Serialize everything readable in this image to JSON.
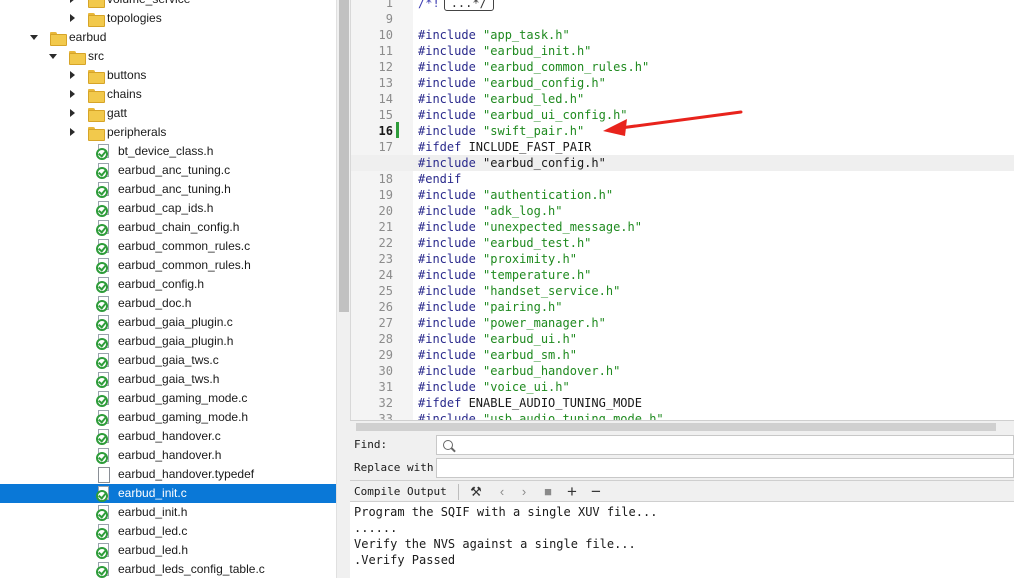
{
  "tree": {
    "items": [
      {
        "label": "volume_service",
        "depth": 3,
        "kind": "folder",
        "expanded": false
      },
      {
        "label": "topologies",
        "depth": 3,
        "kind": "folder",
        "expanded": false
      },
      {
        "label": "earbud",
        "depth": 1,
        "kind": "folder",
        "expanded": true
      },
      {
        "label": "src",
        "depth": 2,
        "kind": "folder",
        "expanded": true
      },
      {
        "label": "buttons",
        "depth": 3,
        "kind": "folder",
        "expanded": false
      },
      {
        "label": "chains",
        "depth": 3,
        "kind": "folder",
        "expanded": false
      },
      {
        "label": "gatt",
        "depth": 3,
        "kind": "folder",
        "expanded": false
      },
      {
        "label": "peripherals",
        "depth": 3,
        "kind": "folder",
        "expanded": false
      },
      {
        "label": "bt_device_class.h",
        "depth": 3,
        "kind": "src"
      },
      {
        "label": "earbud_anc_tuning.c",
        "depth": 3,
        "kind": "src"
      },
      {
        "label": "earbud_anc_tuning.h",
        "depth": 3,
        "kind": "src"
      },
      {
        "label": "earbud_cap_ids.h",
        "depth": 3,
        "kind": "src"
      },
      {
        "label": "earbud_chain_config.h",
        "depth": 3,
        "kind": "src"
      },
      {
        "label": "earbud_common_rules.c",
        "depth": 3,
        "kind": "src"
      },
      {
        "label": "earbud_common_rules.h",
        "depth": 3,
        "kind": "src"
      },
      {
        "label": "earbud_config.h",
        "depth": 3,
        "kind": "src"
      },
      {
        "label": "earbud_doc.h",
        "depth": 3,
        "kind": "src"
      },
      {
        "label": "earbud_gaia_plugin.c",
        "depth": 3,
        "kind": "src"
      },
      {
        "label": "earbud_gaia_plugin.h",
        "depth": 3,
        "kind": "src"
      },
      {
        "label": "earbud_gaia_tws.c",
        "depth": 3,
        "kind": "src"
      },
      {
        "label": "earbud_gaia_tws.h",
        "depth": 3,
        "kind": "src"
      },
      {
        "label": "earbud_gaming_mode.c",
        "depth": 3,
        "kind": "src"
      },
      {
        "label": "earbud_gaming_mode.h",
        "depth": 3,
        "kind": "src"
      },
      {
        "label": "earbud_handover.c",
        "depth": 3,
        "kind": "src"
      },
      {
        "label": "earbud_handover.h",
        "depth": 3,
        "kind": "src"
      },
      {
        "label": "earbud_handover.typedef",
        "depth": 3,
        "kind": "plain"
      },
      {
        "label": "earbud_init.c",
        "depth": 3,
        "kind": "src",
        "selected": true
      },
      {
        "label": "earbud_init.h",
        "depth": 3,
        "kind": "src"
      },
      {
        "label": "earbud_led.c",
        "depth": 3,
        "kind": "src"
      },
      {
        "label": "earbud_led.h",
        "depth": 3,
        "kind": "src"
      },
      {
        "label": "earbud_leds_config_table.c",
        "depth": 3,
        "kind": "src"
      }
    ]
  },
  "editor": {
    "fold_text": "...*/",
    "lines": [
      {
        "num": "1",
        "parts": [
          [
            "cmt",
            "/*!"
          ]
        ],
        "fold": true
      },
      {
        "num": "9",
        "parts": []
      },
      {
        "num": "10",
        "parts": [
          [
            "kw",
            "#include "
          ],
          [
            "str",
            "\"app_task.h\""
          ]
        ]
      },
      {
        "num": "11",
        "parts": [
          [
            "kw",
            "#include "
          ],
          [
            "str",
            "\"earbud_init.h\""
          ]
        ]
      },
      {
        "num": "12",
        "parts": [
          [
            "kw",
            "#include "
          ],
          [
            "str",
            "\"earbud_common_rules.h\""
          ]
        ]
      },
      {
        "num": "13",
        "parts": [
          [
            "kw",
            "#include "
          ],
          [
            "str",
            "\"earbud_config.h\""
          ]
        ]
      },
      {
        "num": "14",
        "parts": [
          [
            "kw",
            "#include "
          ],
          [
            "str",
            "\"earbud_led.h\""
          ]
        ]
      },
      {
        "num": "15",
        "parts": [
          [
            "kw",
            "#include "
          ],
          [
            "str",
            "\"earbud_ui_config.h\""
          ]
        ]
      },
      {
        "num": "16",
        "parts": [
          [
            "kw",
            "#include "
          ],
          [
            "str",
            "\"swift_pair.h\""
          ]
        ],
        "bold": true
      },
      {
        "num": "17",
        "parts": [
          [
            "kw",
            "#ifdef "
          ],
          [
            "txt",
            "INCLUDE_FAST_PAIR"
          ]
        ]
      },
      {
        "num": "",
        "parts": [
          [
            "kw",
            "#include "
          ],
          [
            "txt",
            "\"earbud_config.h\""
          ]
        ],
        "current": true
      },
      {
        "num": "18",
        "parts": [
          [
            "kw",
            "#endif"
          ]
        ]
      },
      {
        "num": "19",
        "parts": [
          [
            "kw",
            "#include "
          ],
          [
            "str",
            "\"authentication.h\""
          ]
        ]
      },
      {
        "num": "20",
        "parts": [
          [
            "kw",
            "#include "
          ],
          [
            "str",
            "\"adk_log.h\""
          ]
        ]
      },
      {
        "num": "21",
        "parts": [
          [
            "kw",
            "#include "
          ],
          [
            "str",
            "\"unexpected_message.h\""
          ]
        ]
      },
      {
        "num": "22",
        "parts": [
          [
            "kw",
            "#include "
          ],
          [
            "str",
            "\"earbud_test.h\""
          ]
        ]
      },
      {
        "num": "23",
        "parts": [
          [
            "kw",
            "#include "
          ],
          [
            "str",
            "\"proximity.h\""
          ]
        ]
      },
      {
        "num": "24",
        "parts": [
          [
            "kw",
            "#include "
          ],
          [
            "str",
            "\"temperature.h\""
          ]
        ]
      },
      {
        "num": "25",
        "parts": [
          [
            "kw",
            "#include "
          ],
          [
            "str",
            "\"handset_service.h\""
          ]
        ]
      },
      {
        "num": "26",
        "parts": [
          [
            "kw",
            "#include "
          ],
          [
            "str",
            "\"pairing.h\""
          ]
        ]
      },
      {
        "num": "27",
        "parts": [
          [
            "kw",
            "#include "
          ],
          [
            "str",
            "\"power_manager.h\""
          ]
        ]
      },
      {
        "num": "28",
        "parts": [
          [
            "kw",
            "#include "
          ],
          [
            "str",
            "\"earbud_ui.h\""
          ]
        ]
      },
      {
        "num": "29",
        "parts": [
          [
            "kw",
            "#include "
          ],
          [
            "str",
            "\"earbud_sm.h\""
          ]
        ]
      },
      {
        "num": "30",
        "parts": [
          [
            "kw",
            "#include "
          ],
          [
            "str",
            "\"earbud_handover.h\""
          ]
        ]
      },
      {
        "num": "31",
        "parts": [
          [
            "kw",
            "#include "
          ],
          [
            "str",
            "\"voice_ui.h\""
          ]
        ]
      },
      {
        "num": "32",
        "parts": [
          [
            "kw",
            "#ifdef "
          ],
          [
            "txt",
            "ENABLE_AUDIO_TUNING_MODE"
          ]
        ]
      },
      {
        "num": "33",
        "parts": [
          [
            "kw",
            "#include "
          ],
          [
            "str",
            "\"usb_audio_tuning_mode.h\""
          ]
        ]
      }
    ]
  },
  "find": {
    "label": "Find:",
    "value": ""
  },
  "replace": {
    "label": "Replace with:",
    "value": ""
  },
  "output": {
    "title": "Compile Output",
    "lines": [
      "Program the SQIF with a single XUV file...",
      "......",
      "Verify the NVS against a single file...",
      ".Verify Passed"
    ]
  },
  "colors": {
    "selection": "#0a78d7",
    "annotation_arrow": "#e8231c",
    "string": "#1f8a1f",
    "keyword": "#2a2a8c"
  }
}
